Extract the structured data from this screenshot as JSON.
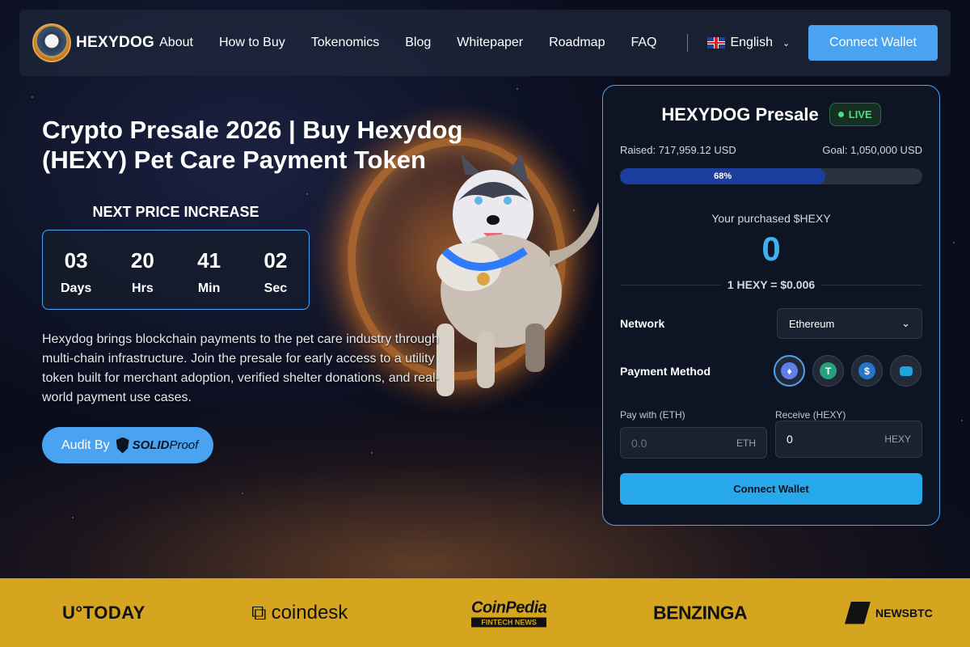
{
  "brand": {
    "name": "HEXYDOG"
  },
  "nav": {
    "items": [
      "About",
      "How to Buy",
      "Tokenomics",
      "Blog",
      "Whitepaper",
      "Roadmap",
      "FAQ"
    ],
    "language": "English",
    "connect_label": "Connect Wallet"
  },
  "hero": {
    "title": "Crypto Presale 2026 | Buy Hexydog (HEXY) Pet Care Payment Token",
    "next_price": "NEXT PRICE INCREASE",
    "countdown": [
      {
        "value": "03",
        "label": "Days"
      },
      {
        "value": "20",
        "label": "Hrs"
      },
      {
        "value": "41",
        "label": "Min"
      },
      {
        "value": "02",
        "label": "Sec"
      }
    ],
    "description": "Hexydog brings blockchain payments to the pet care industry through multi-chain infrastructure. Join the presale for early access to a utility token built for merchant adoption, verified shelter donations, and real-world payment use cases.",
    "audit_label": "Audit By",
    "audit_brand_bold": "SOLID",
    "audit_brand_light": "Proof"
  },
  "presale": {
    "title": "HEXYDOG Presale",
    "status": "LIVE",
    "raised": "Raised: 717,959.12 USD",
    "goal": "Goal: 1,050,000 USD",
    "progress_percent": 68,
    "progress_label": "68%",
    "purchased_label": "Your purchased $HEXY",
    "purchased_value": "0",
    "rate": "1 HEXY = $0.006",
    "network_label": "Network",
    "network_value": "Ethereum",
    "payment_method_label": "Payment Method",
    "payment_methods": [
      "eth-icon",
      "usdt-icon",
      "usdc-icon",
      "card-icon"
    ],
    "pay_label": "Pay with (ETH)",
    "pay_placeholder": "0.0",
    "pay_unit": "ETH",
    "receive_label": "Receive (HEXY)",
    "receive_value": "0",
    "receive_unit": "HEXY",
    "connect_label": "Connect Wallet"
  },
  "press": {
    "logos": [
      "U°TODAY",
      "coindesk",
      "CoinPedia",
      "FINTECH NEWS",
      "BENZINGA",
      "NEWSBTC"
    ]
  },
  "colors": {
    "accent": "#4aa3f0",
    "live": "#4ade80",
    "press_bg": "#d6a520",
    "card_bg": "#0d1524"
  }
}
